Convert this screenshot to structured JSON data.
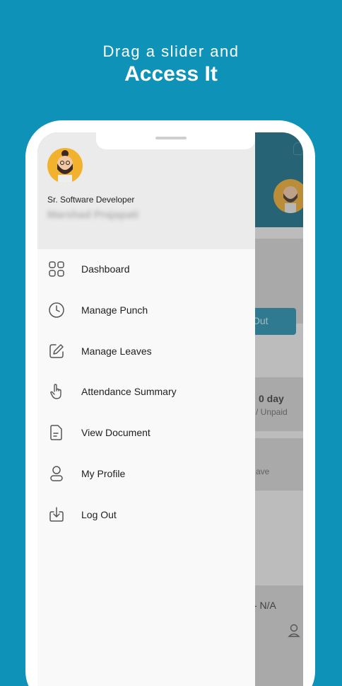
{
  "headline": {
    "line1": "Drag a slider and",
    "line2": "Access It"
  },
  "profile": {
    "designation": "Sr. Software Developer",
    "name": "Marshad Prajapati"
  },
  "menu": [
    {
      "label": "Dashboard",
      "icon": "grid-icon"
    },
    {
      "label": "Manage Punch",
      "icon": "clock-icon"
    },
    {
      "label": "Manage Leaves",
      "icon": "edit-icon"
    },
    {
      "label": "Attendance Summary",
      "icon": "pointer-hand-icon"
    },
    {
      "label": "View Document",
      "icon": "document-icon"
    },
    {
      "label": "My Profile",
      "icon": "user-icon"
    },
    {
      "label": "Log Out",
      "icon": "logout-icon"
    }
  ],
  "background": {
    "punch_button": "Out",
    "leave_count": "0 day",
    "leave_type": "/ Unpaid",
    "leave_label": "ave",
    "status": "- N/A"
  },
  "colors": {
    "page_bg": "#0f92b8",
    "header": "#0b6a85",
    "drawer": "#f9f9f9",
    "drawer_head": "#ebebeb"
  }
}
